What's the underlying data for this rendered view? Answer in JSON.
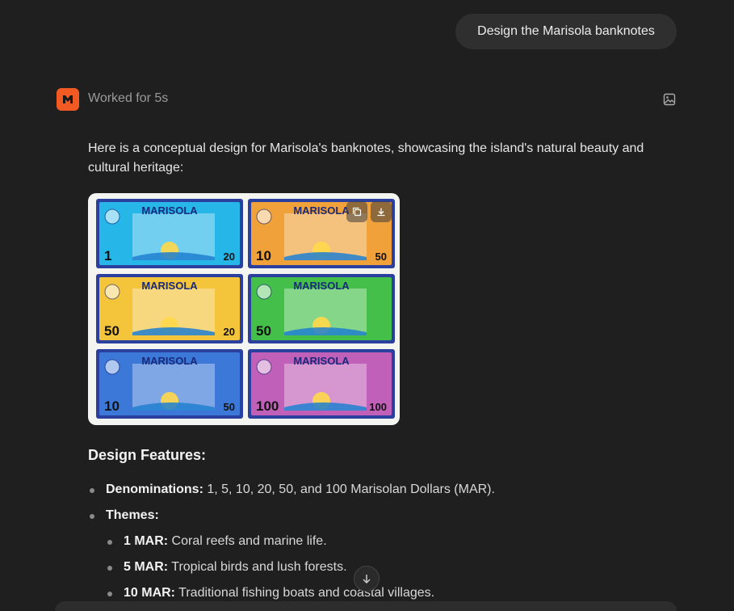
{
  "user_message": "Design the Marisola banknotes",
  "agent": {
    "status": "Worked for 5s",
    "logo_icon": "agent-logo-icon",
    "accent": "#f25a24"
  },
  "response": {
    "intro": "Here is a conceptual design for Marisola's banknotes, showcasing the island's natural beauty and cultural heritage:",
    "image": {
      "alt": "Marisola banknote designs",
      "notes": [
        {
          "title": "MARISOLA",
          "corner_left": "1",
          "corner_right": "20",
          "bg": "#27b6e8"
        },
        {
          "title": "MARISOLA",
          "corner_left": "10",
          "corner_right": "50",
          "bg": "#f0a13a"
        },
        {
          "title": "MARISOLA",
          "corner_left": "50",
          "corner_right": "20",
          "bg": "#f4c43a"
        },
        {
          "title": "MARISOLA",
          "corner_left": "50",
          "corner_right": "",
          "bg": "#44c04a"
        },
        {
          "title": "MARISOLA",
          "corner_left": "10",
          "corner_right": "50",
          "bg": "#3c78d8"
        },
        {
          "title": "MARISOLA",
          "corner_left": "100",
          "corner_right": "100",
          "bg": "#c060b8"
        }
      ]
    },
    "section_title": "Design Features:",
    "features": [
      {
        "level": 1,
        "term": "Denominations:",
        "text": " 1, 5, 10, 20, 50, and 100 Marisolan Dollars (MAR)."
      },
      {
        "level": 1,
        "term": "Themes:",
        "text": ""
      },
      {
        "level": 2,
        "term": "1 MAR:",
        "text": " Coral reefs and marine life."
      },
      {
        "level": 2,
        "term": "5 MAR:",
        "text": " Tropical birds and lush forests."
      },
      {
        "level": 2,
        "term": "10 MAR:",
        "text": " Traditional fishing boats and coastal villages."
      }
    ]
  }
}
